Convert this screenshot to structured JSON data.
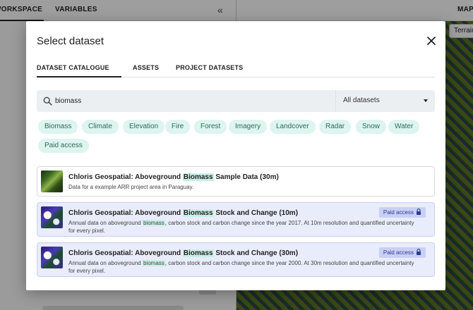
{
  "background": {
    "tabs": {
      "workspace": "WORKSPACE",
      "variables": "VARIABLES",
      "map": "MAP"
    },
    "collapse_glyph": "«",
    "terrain_button": "Terrain"
  },
  "modal": {
    "title": "Select dataset",
    "close_icon": "close-icon",
    "tabs": [
      {
        "label": "DATASET CATALOGUE",
        "active": true
      },
      {
        "label": "ASSETS",
        "active": false
      },
      {
        "label": "PROJECT DATASETS",
        "active": false
      }
    ],
    "search": {
      "value": "biomass",
      "placeholder": ""
    },
    "filter": {
      "selected": "All datasets"
    },
    "chips": [
      "Biomass",
      "Climate",
      "Elevation",
      "Fire",
      "Forest",
      "Imagery",
      "Landcover",
      "Radar",
      "Snow",
      "Water",
      "Paid access"
    ],
    "results": [
      {
        "title_pre": "Chloris Geospatial: Aboveground ",
        "title_hl": "Biomass",
        "title_post": " Sample Data (30m)",
        "desc_pre": "Data for a example ARR project area in Paraguay.",
        "desc_hl": "",
        "desc_post": "",
        "paid": false,
        "badge": ""
      },
      {
        "title_pre": "Chloris Geospatial: Aboveground ",
        "title_hl": "Biomass",
        "title_post": " Stock and Change (10m)",
        "desc_pre": "Annual data on aboveground ",
        "desc_hl": "biomass",
        "desc_post": ", carbon stock and carbon change since the year 2017. At 10m resolution and quantified uncertainty for every pixel.",
        "paid": true,
        "badge": "Paid access"
      },
      {
        "title_pre": "Chloris Geospatial: Aboveground ",
        "title_hl": "Biomass",
        "title_post": " Stock and Change (30m)",
        "desc_pre": "Annual data on aboveground ",
        "desc_hl": "biomass",
        "desc_post": ", carbon stock and carbon change since the year 2000. At 30m resolution and quantified uncertainty for every pixel.",
        "paid": true,
        "badge": "Paid access"
      }
    ]
  },
  "colors": {
    "chip_bg": "#ddf4ef",
    "chip_text": "#2e6a5a",
    "highlight": "#c9efe6",
    "paid_badge_bg": "#c9d0f5",
    "paid_row_bg": "#e9ecfb"
  }
}
